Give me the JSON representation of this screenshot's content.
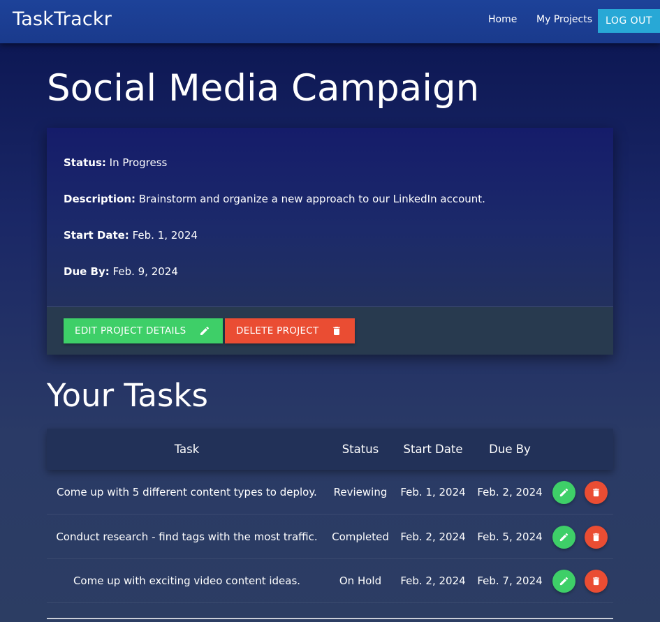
{
  "nav": {
    "brand": "TaskTrackr",
    "home": "Home",
    "my_projects": "My Projects",
    "logout": "LOG OUT"
  },
  "project": {
    "title": "Social Media Campaign",
    "status_label": "Status:",
    "status_value": "In Progress",
    "description_label": "Description:",
    "description_value": "Brainstorm and organize a new approach to our LinkedIn account.",
    "start_label": "Start Date:",
    "start_value": "Feb. 1, 2024",
    "due_label": "Due By:",
    "due_value": "Feb. 9, 2024",
    "edit_button": "EDIT PROJECT DETAILS",
    "delete_button": "DELETE PROJECT"
  },
  "tasks": {
    "title": "Your Tasks",
    "headers": [
      "Task",
      "Status",
      "Start Date",
      "Due By"
    ],
    "rows": [
      {
        "task": "Come up with 5 different content types to deploy.",
        "status": "Reviewing",
        "start": "Feb. 1, 2024",
        "due": "Feb. 2, 2024"
      },
      {
        "task": "Conduct research - find tags with the most traffic.",
        "status": "Completed",
        "start": "Feb. 2, 2024",
        "due": "Feb. 5, 2024"
      },
      {
        "task": "Come up with exciting video content ideas.",
        "status": "On Hold",
        "start": "Feb. 2, 2024",
        "due": "Feb. 7, 2024"
      }
    ]
  },
  "colors": {
    "edit": "#3ecf68",
    "delete": "#ea4d33",
    "logout": "#28a8d6",
    "navbar": "#1d4299"
  },
  "icons": {
    "edit": "pencil-icon",
    "delete": "trash-icon"
  }
}
